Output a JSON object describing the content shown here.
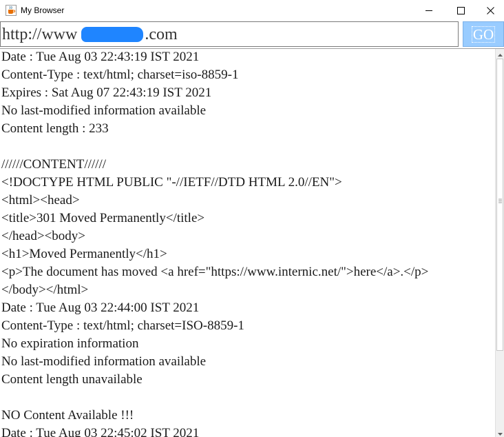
{
  "window": {
    "title": "My Browser",
    "icon": "java-cup-icon"
  },
  "address_bar": {
    "url_prefix": "http://www",
    "url_suffix": ".com",
    "go_label": "GO"
  },
  "colors": {
    "go_button_bg": "#99ccff",
    "redaction": "#1f85ff",
    "text": "#1a1a1a"
  },
  "content": {
    "lines": [
      "Date : Tue Aug 03 22:43:19 IST 2021",
      "Content-Type : text/html; charset=iso-8859-1",
      "Expires : Sat Aug 07 22:43:19 IST 2021",
      "No last-modified information available",
      "Content length : 233",
      "",
      "//////CONTENT//////",
      "<!DOCTYPE HTML PUBLIC \"-//IETF//DTD HTML 2.0//EN\">",
      "<html><head>",
      "<title>301 Moved Permanently</title>",
      "</head><body>",
      "<h1>Moved Permanently</h1>",
      "<p>The document has moved <a href=\"https://www.internic.net/\">here</a>.</p>",
      "</body></html>",
      "Date : Tue Aug 03 22:44:00 IST 2021",
      "Content-Type : text/html; charset=ISO-8859-1",
      "No expiration information",
      "No last-modified information available",
      "Content length unavailable",
      "",
      "NO Content Available !!!",
      "Date : Tue Aug 03 22:45:02 IST 2021"
    ]
  }
}
